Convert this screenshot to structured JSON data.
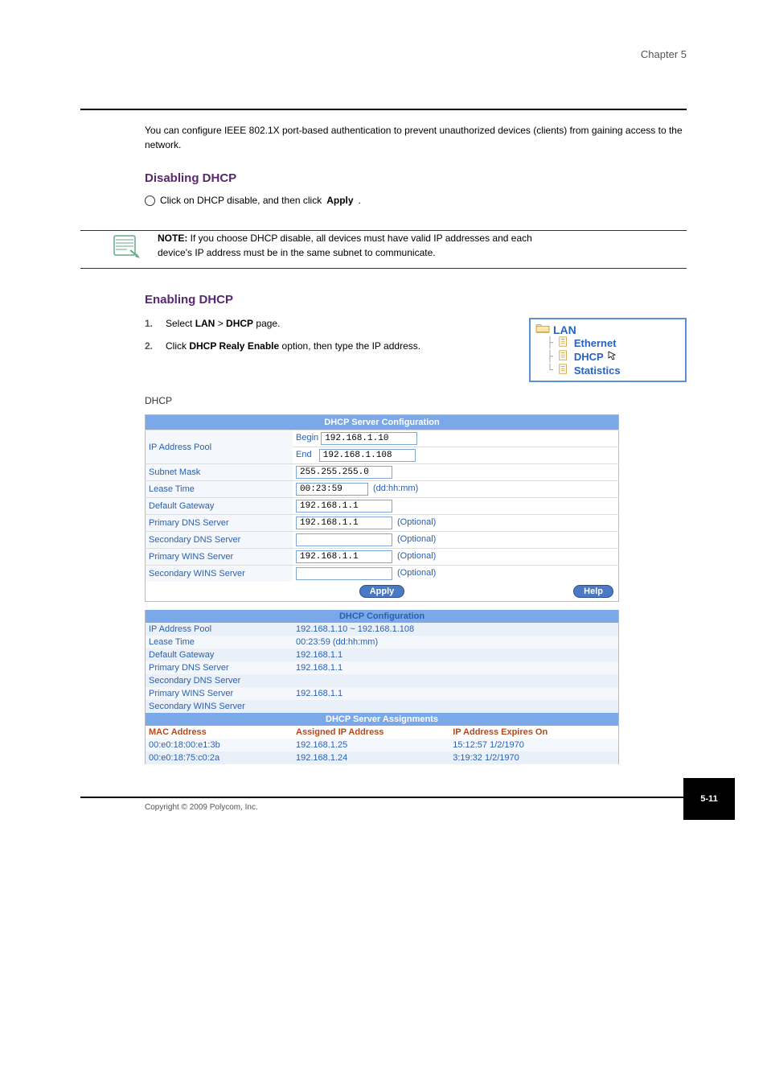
{
  "chapter": "Chapter 5",
  "intro": "You can configure IEEE 802.1X port-based authentication to prevent unauthorized devices (clients) from gaining access to the network.",
  "heading1": "Disabling DHCP",
  "dhcpDisable": {
    "text": "Click on DHCP disable, and then click ",
    "bold": "Apply",
    "end": "."
  },
  "note": {
    "prefix": "NOTE: ",
    "line1": "If you choose DHCP disable, all devices must have valid IP addresses and each",
    "line2": "device's IP address must be in the same subnet to communicate."
  },
  "heading2": "Enabling DHCP",
  "step1": {
    "n": "1.",
    "pre": "Select ",
    "b1": "LAN",
    ">": " > ",
    "b2": "DHCP",
    "post": " page."
  },
  "step2": {
    "n": "2.",
    "pre": "Click ",
    "b1": "DHCP Realy Enable",
    "post": " option, then type the IP address."
  },
  "nav": {
    "root": "LAN",
    "items": [
      "Ethernet",
      "DHCP",
      "Statistics"
    ]
  },
  "dhcpHeading": "DHCP",
  "panel1": {
    "title": "DHCP Server Configuration",
    "rows": {
      "pool": {
        "label": "IP Address Pool",
        "begin": "Begin",
        "end": "End",
        "beginVal": "192.168.1.10",
        "endVal": "192.168.1.108"
      },
      "subnet": {
        "label": "Subnet Mask",
        "val": "255.255.255.0"
      },
      "lease": {
        "label": "Lease Time",
        "val": "00:23:59",
        "suffix": "(dd:hh:mm)"
      },
      "gateway": {
        "label": "Default Gateway",
        "val": "192.168.1.1"
      },
      "dns1": {
        "label": "Primary DNS Server",
        "val": "192.168.1.1",
        "opt": "(Optional)"
      },
      "dns2": {
        "label": "Secondary DNS Server",
        "val": "",
        "opt": "(Optional)"
      },
      "wins1": {
        "label": "Primary WINS Server",
        "val": "192.168.1.1",
        "opt": "(Optional)"
      },
      "wins2": {
        "label": "Secondary WINS Server",
        "val": "",
        "opt": "(Optional)"
      }
    },
    "apply": "Apply",
    "help": "Help"
  },
  "panel2": {
    "title": "DHCP Configuration",
    "rows": [
      {
        "label": "IP Address Pool",
        "val": "192.168.1.10 ~ 192.168.1.108"
      },
      {
        "label": "Lease Time",
        "val": "00:23:59 (dd:hh:mm)"
      },
      {
        "label": "Default Gateway",
        "val": "192.168.1.1"
      },
      {
        "label": "Primary DNS Server",
        "val": "192.168.1.1"
      },
      {
        "label": "Secondary DNS Server",
        "val": ""
      },
      {
        "label": "Primary WINS Server",
        "val": "192.168.1.1"
      },
      {
        "label": "Secondary WINS Server",
        "val": ""
      }
    ],
    "assignTitle": "DHCP Server Assignments",
    "cols": [
      "MAC Address",
      "Assigned IP Address",
      "IP Address Expires On"
    ],
    "assigns": [
      {
        "mac": "00:e0:18:00:e1:3b",
        "ip": "192.168.1.25",
        "exp": "15:12:57 1/2/1970"
      },
      {
        "mac": "00:e0:18:75:c0:2a",
        "ip": "192.168.1.24",
        "exp": "3:19:32 1/2/1970"
      }
    ]
  },
  "pagenum": "5-11",
  "copyright": "Copyright © 2009 Polycom, Inc."
}
